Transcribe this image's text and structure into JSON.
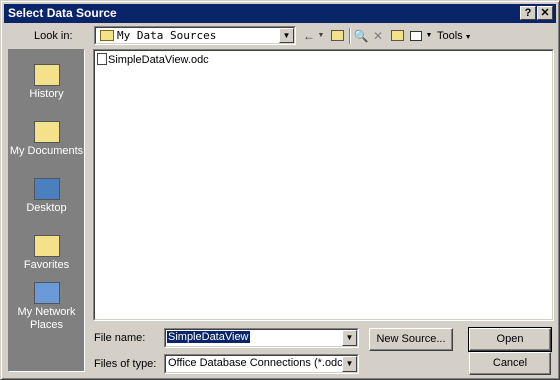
{
  "window": {
    "title": "Select Data Source",
    "help_button": "?",
    "close_button": "✕"
  },
  "toolbar": {
    "lookin_label": "Look in:",
    "lookin_value": "My Data Sources",
    "tools_label": "Tools"
  },
  "places": [
    {
      "label": "History"
    },
    {
      "label": "My Documents"
    },
    {
      "label": "Desktop"
    },
    {
      "label": "Favorites"
    },
    {
      "label": "My Network Places"
    }
  ],
  "files": [
    {
      "name": "SimpleDataView.odc"
    }
  ],
  "bottom": {
    "filename_label": "File name:",
    "filename_value": "SimpleDataView",
    "filetype_label": "Files of type:",
    "filetype_value": "Office Database Connections (*.odc)",
    "new_source_button": "New Source...",
    "open_button": "Open",
    "cancel_button": "Cancel"
  }
}
